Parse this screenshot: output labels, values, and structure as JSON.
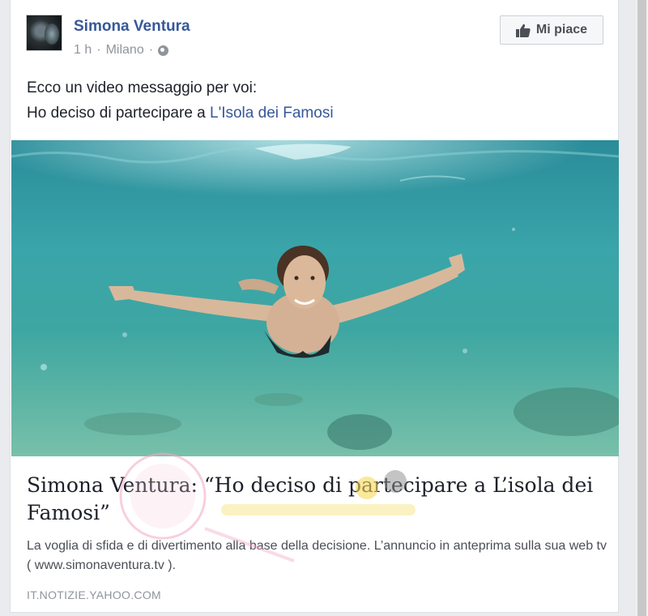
{
  "post": {
    "author": "Simona Ventura",
    "time": "1 h",
    "location": "Milano",
    "separator": "·",
    "privacy_icon": "globe-icon",
    "like_page_label": "Mi piace",
    "text_line1": "Ecco un video messaggio per voi:",
    "text_line2_prefix": "Ho deciso di partecipare a ",
    "text_link": "L'Isola dei Famosi"
  },
  "link_preview": {
    "headline": "Simona Ventura: “Ho deciso di partecipare a L’isola dei Famosi”",
    "description": "La voglia di sfida e di divertimento alla base della decisione. L’annuncio in anteprima sulla sua web tv ( www.simonaventura.tv ).",
    "domain": "IT.NOTIZIE.YAHOO.COM"
  },
  "colors": {
    "link": "#365899",
    "meta": "#90949c",
    "water": "#3aa2a0"
  }
}
